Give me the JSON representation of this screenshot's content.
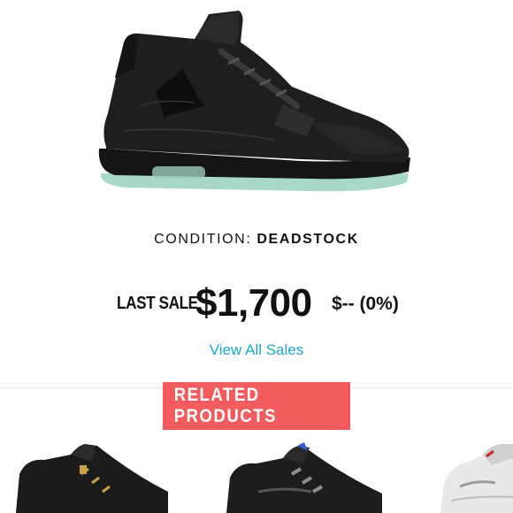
{
  "product": {
    "image_icon": "black-sneaker-icon",
    "condition_label": "CONDITION:",
    "condition_value": "DEADSTOCK"
  },
  "sale": {
    "label": "LAST SALE",
    "price": "$1,700",
    "change": "$-- (0%)"
  },
  "links": {
    "view_all_sales": "View All Sales"
  },
  "related": {
    "title": "RELATED PRODUCTS",
    "items": [
      {
        "icon": "black-gold-sneaker-icon"
      },
      {
        "icon": "black-grey-sneaker-icon"
      },
      {
        "icon": "white-cement-sneaker-icon"
      }
    ]
  },
  "colors": {
    "accent_link": "#1fa6c7",
    "banner": "#f25c5f",
    "text": "#111111"
  }
}
